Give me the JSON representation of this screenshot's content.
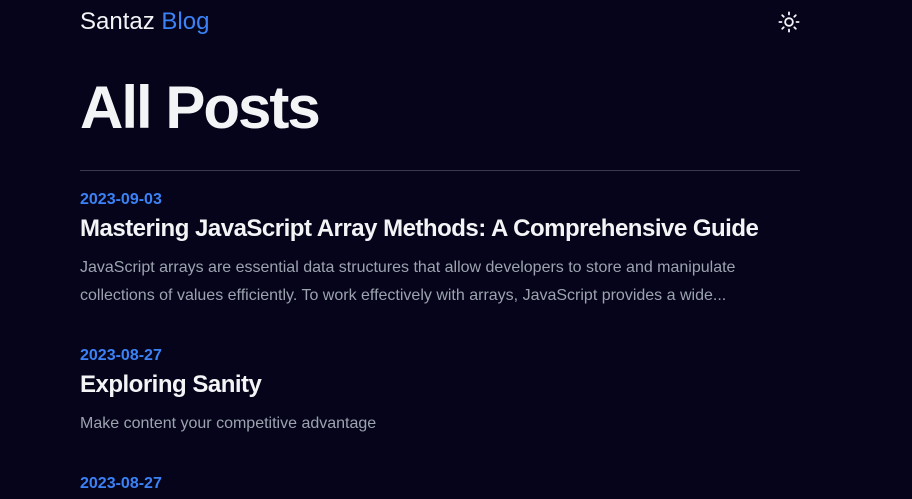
{
  "header": {
    "brand_name": "Santaz",
    "brand_accent": "Blog",
    "theme_toggle_icon": "sun-icon"
  },
  "main": {
    "title": "All Posts",
    "posts": [
      {
        "date": "2023-09-03",
        "title": "Mastering JavaScript Array Methods: A Comprehensive Guide",
        "excerpt": "JavaScript arrays are essential data structures that allow developers to store and manipulate collections of values efficiently. To work effectively with arrays, JavaScript provides a wide..."
      },
      {
        "date": "2023-08-27",
        "title": "Exploring Sanity",
        "excerpt": "Make content your competitive advantage"
      },
      {
        "date": "2023-08-27"
      }
    ]
  },
  "colors": {
    "background": "#05041a",
    "accent": "#3b82f6",
    "text": "#f3f4f6",
    "muted": "#9ca3af"
  }
}
